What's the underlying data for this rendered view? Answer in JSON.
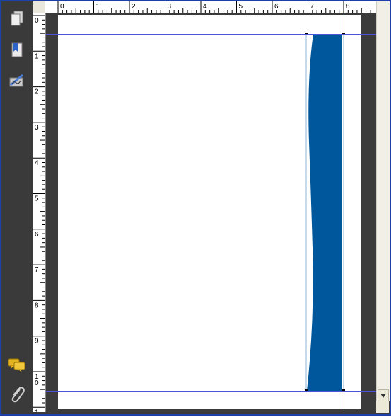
{
  "sidebar": {
    "items": [
      {
        "name": "pages-icon"
      },
      {
        "name": "bookmarks-icon"
      },
      {
        "name": "signatures-icon"
      },
      {
        "name": "comments-icon"
      },
      {
        "name": "attachments-icon"
      }
    ]
  },
  "rulers": {
    "top_labels": [
      "0",
      "1",
      "2",
      "3",
      "4",
      "5",
      "6",
      "7",
      "8"
    ],
    "left_labels": [
      "0",
      "1",
      "2",
      "3",
      "4",
      "5",
      "6",
      "7",
      "8",
      "9",
      "1\n0",
      "1"
    ]
  },
  "shape": {
    "fill": "#01579b",
    "stroke": "#4a6fb5"
  },
  "colors": {
    "workspace": "#3b3b3b",
    "guide": "#4b56d6",
    "frame": "#1f3fa8"
  }
}
